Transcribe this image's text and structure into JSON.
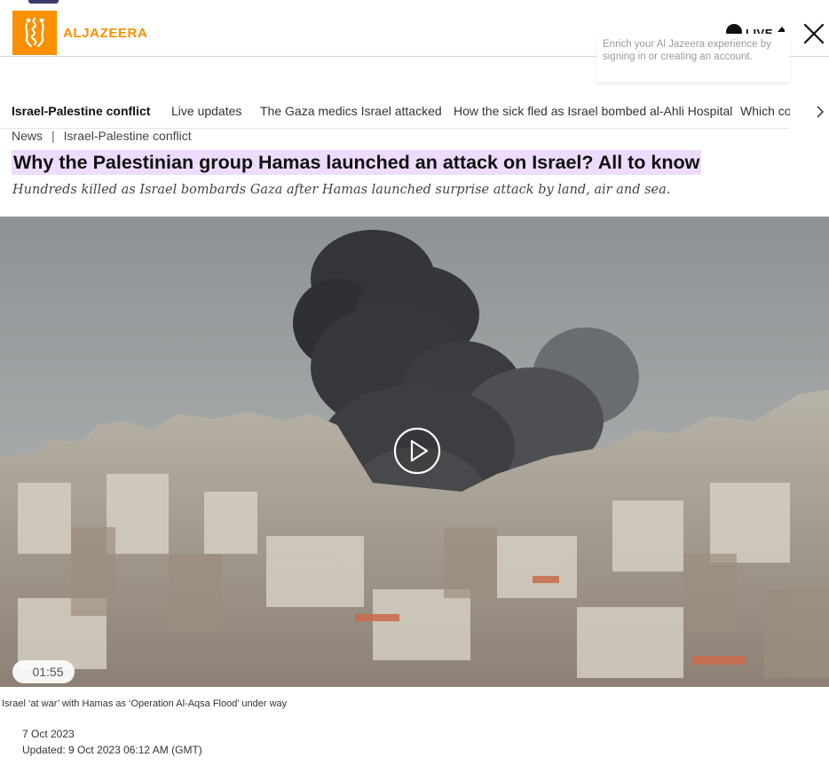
{
  "header": {
    "logo_text": "ALJAZEERA",
    "live_label": "LIVE",
    "tooltip": "Enrich your Al Jazeera experience by signing in or creating an account."
  },
  "topic_nav": {
    "items": [
      "Israel-Palestine conflict",
      "Live updates",
      "The Gaza medics Israel attacked",
      "How the sick fled as Israel bombed al-Ahli Hospital",
      "Which co"
    ]
  },
  "breadcrumb": {
    "section": "News",
    "separator": "|",
    "topic": "Israel-Palestine conflict"
  },
  "article": {
    "title": "Why the Palestinian group Hamas launched an attack on Israel? All to know",
    "subtitle": "Hundreds killed as Israel bombards Gaza after Hamas launched surprise attack by land, air and sea.",
    "video_duration": "01:55",
    "caption": "Israel ‘at war’ with Hamas as ‘Operation Al-Aqsa Flood’ under way",
    "published": "7 Oct 2023",
    "updated": "Updated: 9 Oct 2023 06:12 AM (GMT)"
  },
  "colors": {
    "brand_orange": "#fa9000",
    "title_highlight": "#eedcff"
  },
  "icons": {
    "logo": "aljazeera-calligraphy-icon",
    "live": "live-dot-icon",
    "close": "close-icon",
    "nav_next": "chevron-right-icon",
    "play": "play-icon"
  }
}
